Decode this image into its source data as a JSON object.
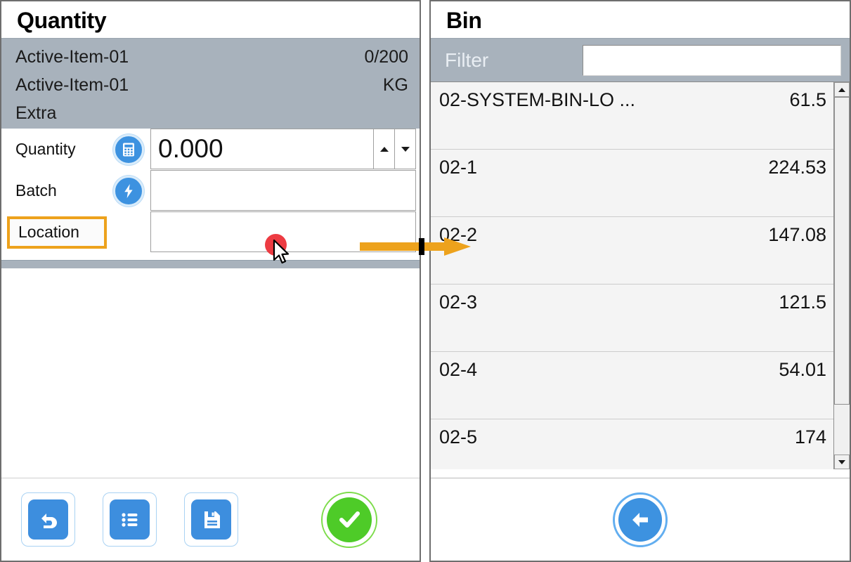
{
  "quantity_panel": {
    "title": "Quantity",
    "info": {
      "line1_left": "Active-Item-01",
      "line1_right": "0/200",
      "line2_left": "Active-Item-01",
      "line2_right": "KG",
      "line3_left": "Extra",
      "line3_right": ""
    },
    "fields": [
      {
        "label": "Quantity",
        "value": "0.000",
        "icon": "calculator-icon"
      },
      {
        "label": "Batch",
        "value": "",
        "icon": "lightning-bolt-icon"
      },
      {
        "label": "Location",
        "value": "",
        "icon": ""
      }
    ],
    "spinner": {
      "up": "▲",
      "down": "▼"
    },
    "toolbar": {
      "back_label": "back-arrow-icon",
      "list_label": "list-icon",
      "save_label": "save-disk-icon",
      "confirm_label": "check-icon"
    }
  },
  "bin_panel": {
    "title": "Bin",
    "filter": {
      "label": "Filter",
      "value": "",
      "placeholder": ""
    },
    "rows": [
      {
        "name": "02-SYSTEM-BIN-LO ...",
        "qty": "61.5"
      },
      {
        "name": "02-1",
        "qty": "224.53"
      },
      {
        "name": "02-2",
        "qty": "147.08"
      },
      {
        "name": "02-3",
        "qty": "121.5"
      },
      {
        "name": "02-4",
        "qty": "54.01"
      },
      {
        "name": "02-5",
        "qty": "174"
      }
    ],
    "scrollbar": {
      "up": "▲",
      "down": "▼"
    },
    "footer": {
      "back_label": "back-arrow-icon"
    }
  },
  "annotations": {
    "arrow_color": "#eda21c",
    "click_dot_color": "#ed3b42",
    "highlight_color": "#eda21c"
  }
}
